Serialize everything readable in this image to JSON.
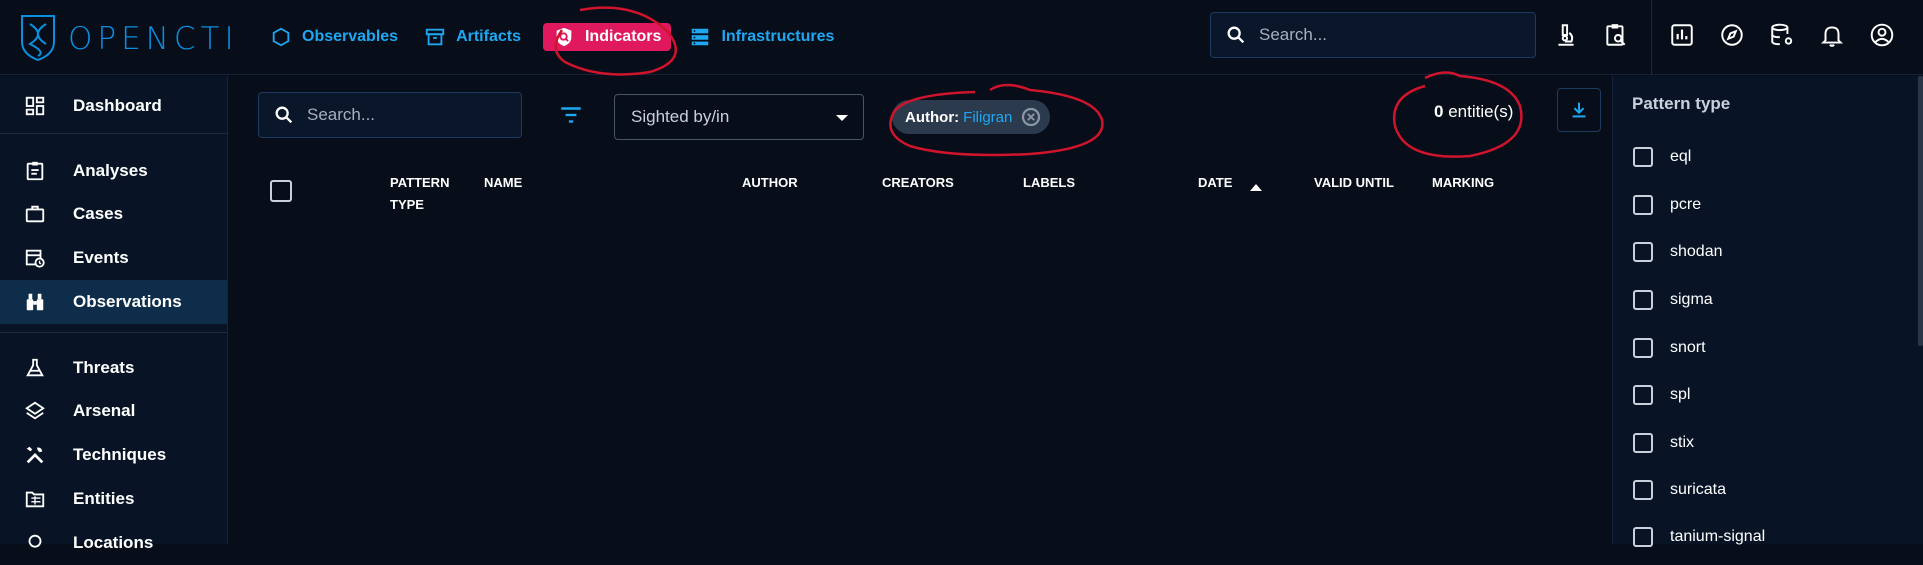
{
  "app": {
    "logo_text": "OPENCTI"
  },
  "topnav": [
    {
      "label": "Observables",
      "icon": "hexagon-icon",
      "active": false
    },
    {
      "label": "Artifacts",
      "icon": "archive-icon",
      "active": false
    },
    {
      "label": "Indicators",
      "icon": "shield-search-icon",
      "active": true
    },
    {
      "label": "Infrastructures",
      "icon": "server-icon",
      "active": false
    }
  ],
  "top_search": {
    "placeholder": "Search..."
  },
  "sidebar": {
    "items": [
      {
        "label": "Dashboard",
        "icon": "dashboard-icon",
        "active": false
      },
      {
        "label": "Analyses",
        "icon": "clipboard-icon",
        "active": false
      },
      {
        "label": "Cases",
        "icon": "briefcase-icon",
        "active": false
      },
      {
        "label": "Events",
        "icon": "calendar-clock-icon",
        "active": false
      },
      {
        "label": "Observations",
        "icon": "binoculars-icon",
        "active": true
      },
      {
        "label": "Threats",
        "icon": "flask-icon",
        "active": false
      },
      {
        "label": "Arsenal",
        "icon": "layers-icon",
        "active": false
      },
      {
        "label": "Techniques",
        "icon": "tools-icon",
        "active": false
      },
      {
        "label": "Entities",
        "icon": "folder-table-icon",
        "active": false
      },
      {
        "label": "Locations",
        "icon": "location-icon",
        "active": false
      }
    ]
  },
  "list": {
    "search_placeholder": "Search...",
    "sighted_label": "Sighted by/in",
    "filter_chip": {
      "key": "Author",
      "value": "Filigran"
    },
    "count_value": "0",
    "count_label": " entitie(s)",
    "columns": [
      "Pattern type",
      "Name",
      "Author",
      "Creators",
      "Labels",
      "Date",
      "Valid until",
      "Marking"
    ],
    "sort_column": "Date"
  },
  "right_panel": {
    "title": "Pattern type",
    "options": [
      "eql",
      "pcre",
      "shodan",
      "sigma",
      "snort",
      "spl",
      "stix",
      "suricata",
      "tanium-signal"
    ]
  },
  "colors": {
    "accent": "#1ea8f2",
    "active_tab": "#e0195e",
    "annotation": "#d0142c"
  }
}
